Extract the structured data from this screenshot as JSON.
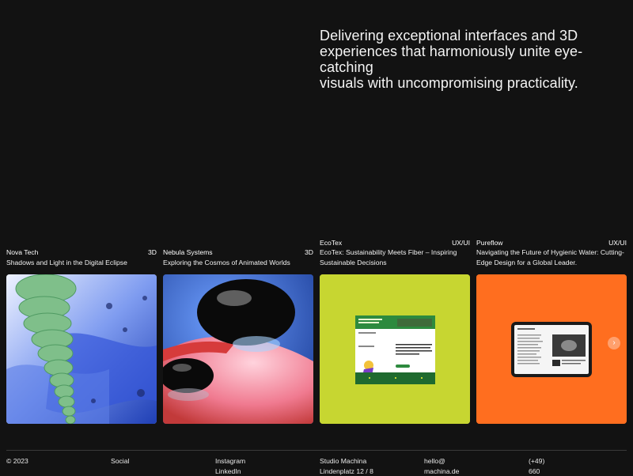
{
  "hero": {
    "line1": "Delivering exceptional interfaces and 3D",
    "line2": "experiences that harmoniously unite eye-catching",
    "line3": "visuals with uncompromising practicality."
  },
  "projects": [
    {
      "client": "Nova Tech",
      "tag": "3D",
      "title": "Shadows and Light in the Digital Eclipse",
      "image_bg": "#4b6fe0"
    },
    {
      "client": "Nebula Systems",
      "tag": "3D",
      "title": "Exploring the Cosmos of Animated Worlds",
      "image_bg": "#2a57b8"
    },
    {
      "client": "EcoTex",
      "tag": "UX/UI",
      "title_line1": "EcoTex: Sustainability Meets Fiber – Inspiring",
      "title_line2": "Sustainable Decisions",
      "image_bg": "#c7d631"
    },
    {
      "client": "Pureflow",
      "tag": "UX/UI",
      "title_line1": "Navigating the Future of Hygienic Water: Cutting-",
      "title_line2": "Edge Design for a Global Leader.",
      "image_bg": "#ff6e1f"
    }
  ],
  "mockup3": {
    "heading_lines": [
      "Beyond Boundaries: Holistic",
      "Value Chain Thinking in",
      "Action for Sustainable Textile",
      "Production"
    ]
  },
  "carousel": {
    "next_icon": "chevron-right-icon"
  },
  "footer": {
    "copyright": "© 2023",
    "social_label": "Social",
    "social_links": [
      "Instagram",
      "LinkedIn"
    ],
    "studio_name": "Studio Machina",
    "studio_address": "Lindenplatz 12 / 8",
    "email_line1": "hello@",
    "email_line2": "machina.de",
    "phone_line1": "(+49)",
    "phone_line2": "660"
  }
}
